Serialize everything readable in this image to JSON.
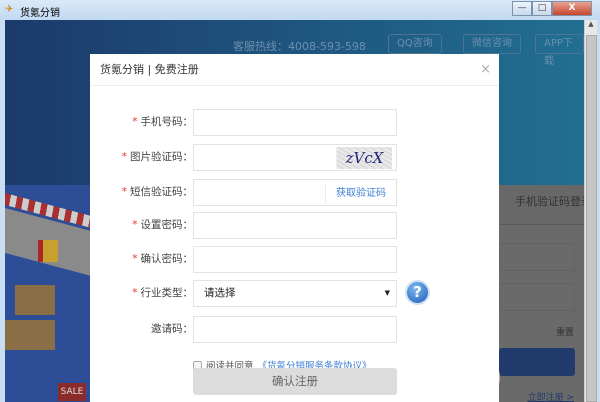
{
  "window": {
    "title": "货氪分销",
    "minimize": "—",
    "maximize": "□",
    "close": "X"
  },
  "header": {
    "hotline": "客服热线：4008-593-598",
    "qq": "QQ咨询",
    "wechat": "微信咨询",
    "app": "APP下载"
  },
  "illustration": {
    "sale": "SALE"
  },
  "login_panel": {
    "tab": "手机验证码登录",
    "reset": "重置",
    "register_link": "立即注册 >"
  },
  "dialog": {
    "title": "货氪分销 | 免费注册",
    "close": "×",
    "fields": [
      {
        "label": "手机号码：",
        "required": "*",
        "value": ""
      },
      {
        "label": "图片验证码：",
        "required": "*",
        "value": "",
        "captcha": "zVcX"
      },
      {
        "label": "短信验证码：",
        "required": "*",
        "value": "",
        "action": "获取验证码"
      },
      {
        "label": "设置密码：",
        "required": "*",
        "value": ""
      },
      {
        "label": "确认密码：",
        "required": "*",
        "value": ""
      },
      {
        "label": "行业类型：",
        "required": "*",
        "selected": "请选择",
        "help": "?"
      },
      {
        "label": "邀请码：",
        "value": ""
      }
    ],
    "agree_text": "阅读并同意",
    "agree_link": "《货氪分销服务条款协议》",
    "submit": "确认注册"
  }
}
